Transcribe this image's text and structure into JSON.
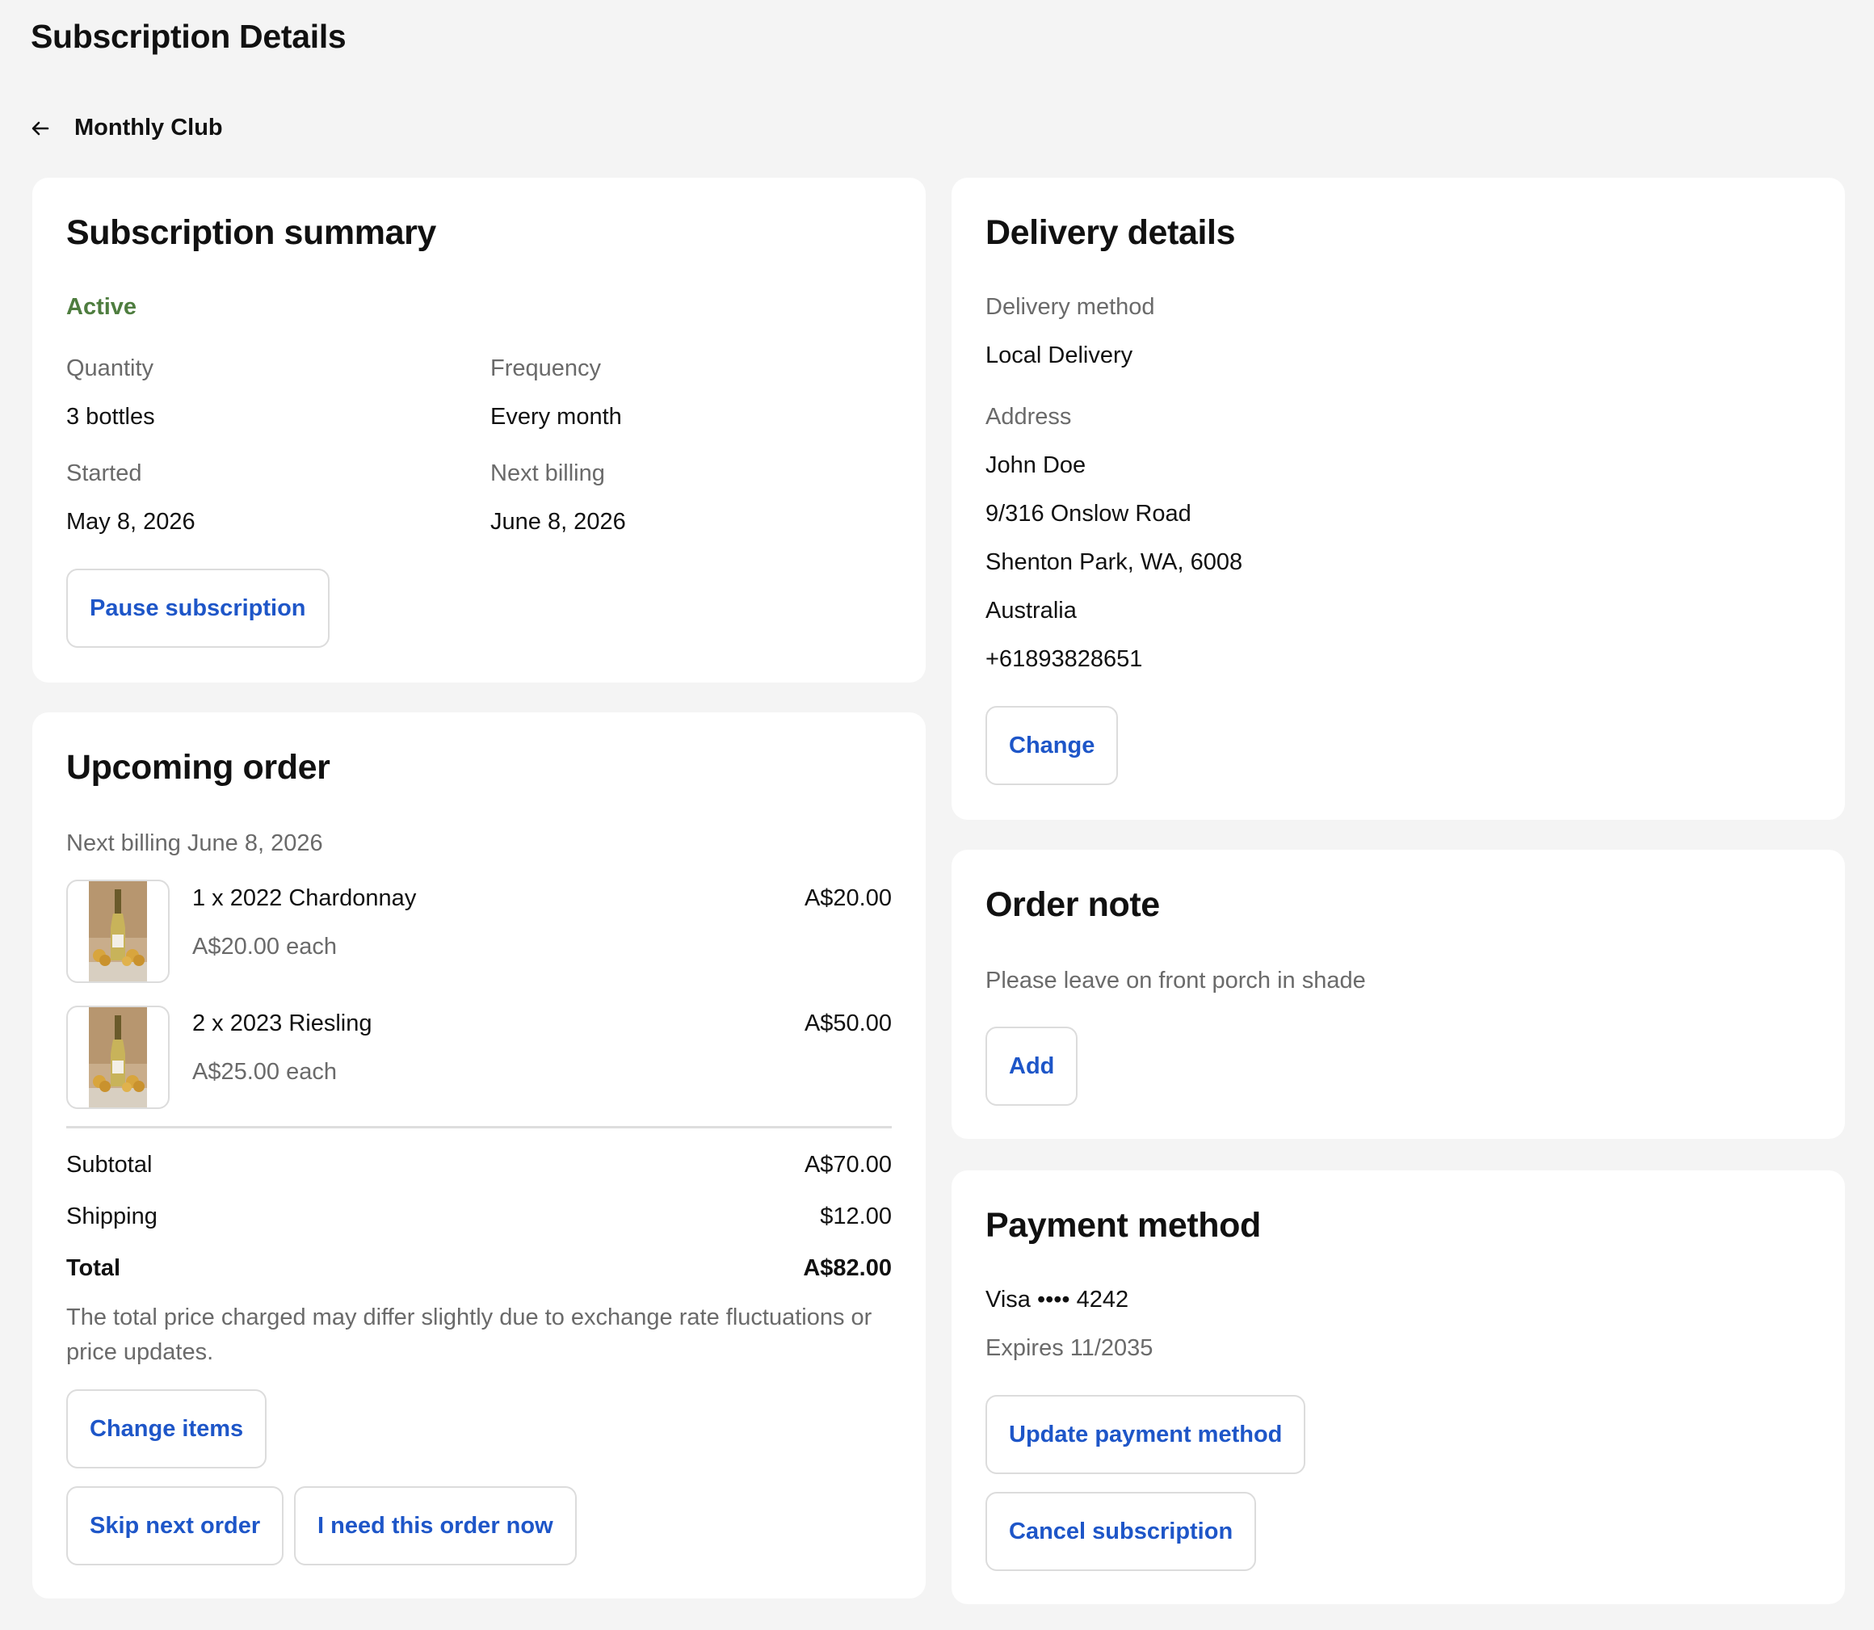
{
  "page": {
    "title": "Subscription Details"
  },
  "nav": {
    "back_label": "Monthly Club"
  },
  "summary": {
    "title": "Subscription summary",
    "status": "Active",
    "quantity_label": "Quantity",
    "quantity_value": "3 bottles",
    "frequency_label": "Frequency",
    "frequency_value": "Every month",
    "started_label": "Started",
    "started_value": "May 8, 2026",
    "next_billing_label": "Next billing",
    "next_billing_value": "June 8, 2026",
    "pause_label": "Pause subscription"
  },
  "order": {
    "title": "Upcoming order",
    "next_billing_text": "Next billing June 8, 2026",
    "items": [
      {
        "name": "1 x 2022 Chardonnay",
        "each": "A$20.00 each",
        "price": "A$20.00"
      },
      {
        "name": "2 x 2023 Riesling",
        "each": "A$25.00 each",
        "price": "A$50.00"
      }
    ],
    "subtotal_label": "Subtotal",
    "subtotal_value": "A$70.00",
    "shipping_label": "Shipping",
    "shipping_value": "$12.00",
    "total_label": "Total",
    "total_value": "A$82.00",
    "disclaimer": "The total price charged may differ slightly due to exchange rate fluctuations or price updates.",
    "change_items_label": "Change items",
    "skip_label": "Skip next order",
    "order_now_label": "I need this order now"
  },
  "delivery": {
    "title": "Delivery details",
    "method_label": "Delivery method",
    "method_value": "Local Delivery",
    "address_label": "Address",
    "name": "John Doe",
    "street": "9/316 Onslow Road",
    "city_line": "Shenton Park, WA, 6008",
    "country": "Australia",
    "phone": "+61893828651",
    "change_label": "Change"
  },
  "note": {
    "title": "Order note",
    "text": "Please leave on front porch in shade",
    "add_label": "Add"
  },
  "payment": {
    "title": "Payment method",
    "card_line": "Visa •••• 4242",
    "expires": "Expires 11/2035",
    "update_label": "Update payment method",
    "cancel_label": "Cancel subscription"
  },
  "icons": {
    "back": "arrow-left-icon",
    "product_image": "wine-bottle-image"
  },
  "colors": {
    "accent": "#1e56c8",
    "status_active": "#4e7d3f",
    "background": "#f4f4f4"
  }
}
